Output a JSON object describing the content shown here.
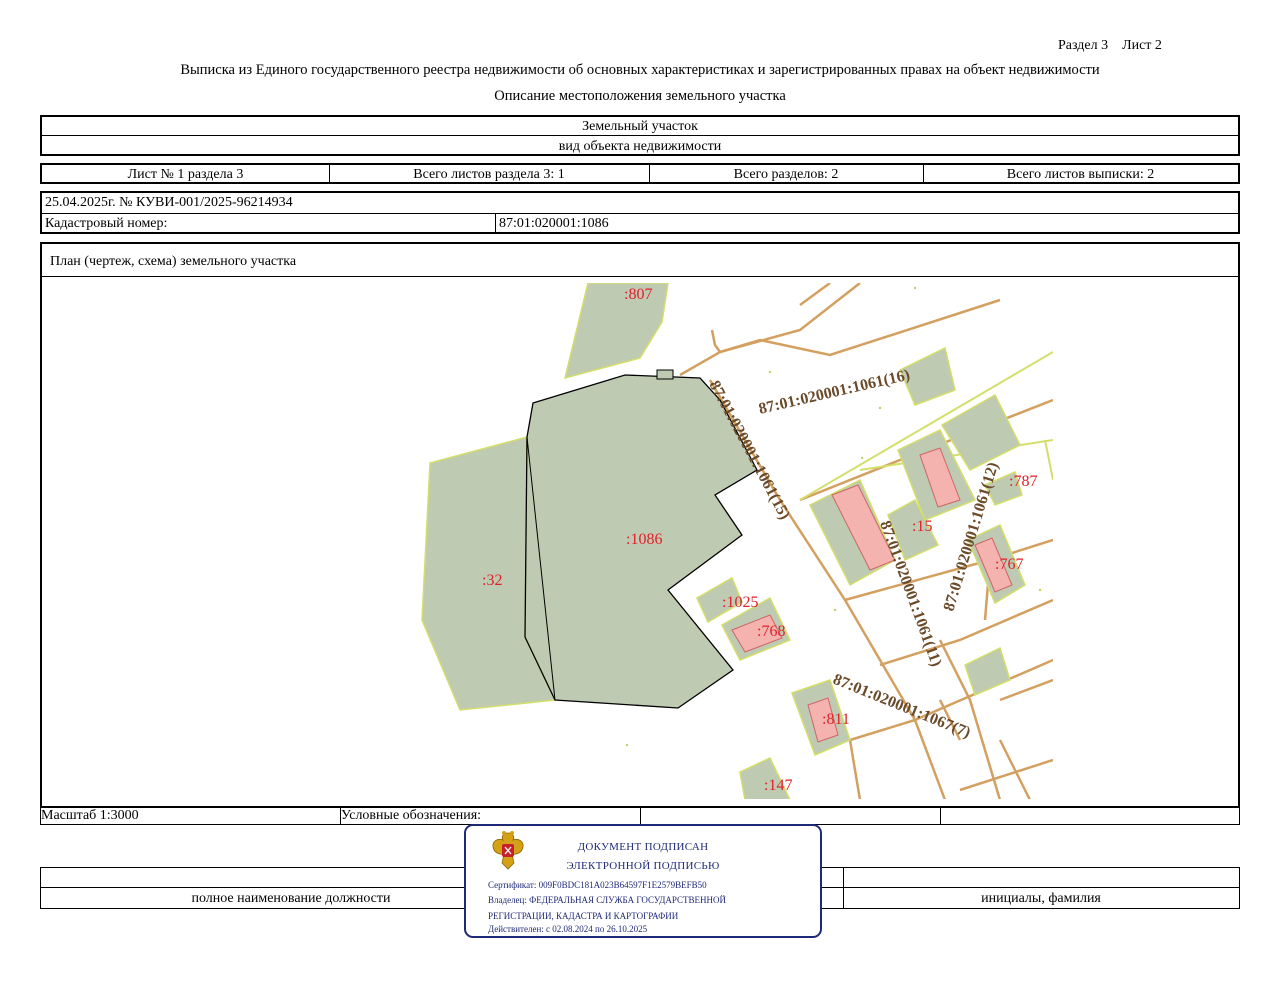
{
  "header": {
    "section_sheet": "Раздел 3    Лист 2",
    "title": "Выписка из Единого государственного реестра недвижимости об основных характеристиках и зарегистрированных правах на объект недвижимости",
    "subtitle": "Описание местоположения земельного участка"
  },
  "object": {
    "type_value": "Земельный участок",
    "type_caption": "вид объекта недвижимости"
  },
  "sheets": {
    "sheet": "Лист № 1 раздела 3",
    "total_section_sheets": "Всего листов раздела 3: 1",
    "total_sections": "Всего разделов: 2",
    "total_extract_sheets": "Всего листов выписки: 2"
  },
  "doc": {
    "date_number": "25.04.2025г. № КУВИ-001/2025-96214934",
    "cadastral_label": "Кадастровый номер:",
    "cadastral_value": "87:01:020001:1086"
  },
  "plan": {
    "title": "План (чертеж, схема) земельного участка",
    "labels": {
      "p807": ":807",
      "p1086": ":1086",
      "p32": ":32",
      "p1025": ":1025",
      "p768": ":768",
      "p811": ":811",
      "p147": ":147",
      "p15": ":15",
      "p787": ":787",
      "p767": ":767",
      "q16": "87:01:020001:1061(16)",
      "q15": "87:01:020001:1061(15)",
      "q12": "87:01:020001:1061(12)",
      "q11": "87:01:020001:1061(11)",
      "q7": "87:01:020001:1067(7)"
    }
  },
  "footer": {
    "scale": "Масштаб 1:3000",
    "legend": "Условные обозначения:",
    "position_caption": "полное наименование должности",
    "name_caption": "инициалы, фамилия"
  },
  "stamp": {
    "line1": "ДОКУМЕНТ ПОДПИСАН",
    "line2": "ЭЛЕКТРОННОЙ ПОДПИСЬЮ",
    "certificate": "Сертификат: 009F0BDC181A023B64597F1E2579BEFB50",
    "owner1": "Владелец: ФЕДЕРАЛЬНАЯ СЛУЖБА ГОСУДАРСТВЕННОЙ",
    "owner2": "РЕГИСТРАЦИИ, КАДАСТРА И КАРТОГРАФИИ",
    "valid": "Действителен: с 02.08.2024 по 26.10.2025"
  },
  "colors": {
    "parcel_fill": "#bfcab2",
    "parcel_edge": "#d4de6a",
    "building_fill": "#f5b3b0",
    "road": "#d3a060",
    "label_red": "#e0202a",
    "label_brown": "#6b4a2a",
    "stamp_blue": "#1e2a78"
  }
}
